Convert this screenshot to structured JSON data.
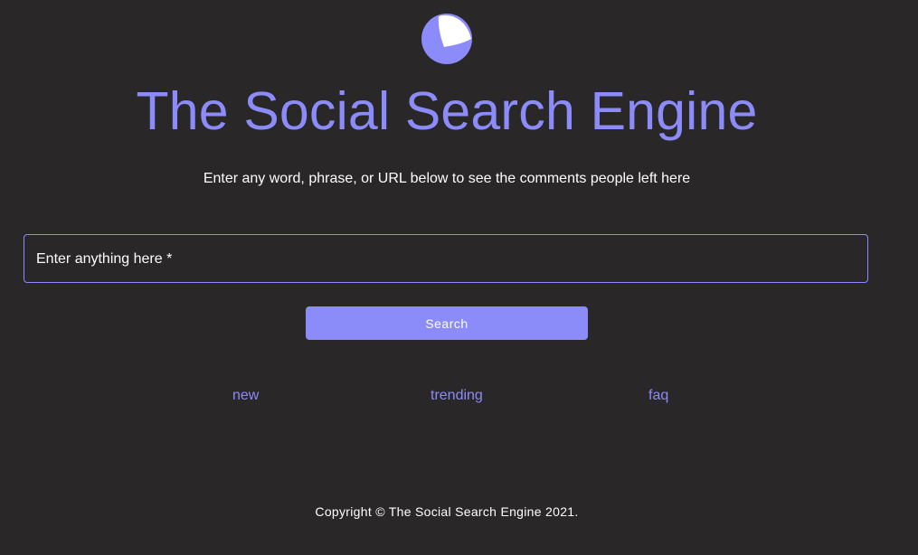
{
  "header": {
    "logo_icon": "moon-logo-icon",
    "title": "The Social Search Engine",
    "subtitle": "Enter any word, phrase, or URL below to see the comments people left here"
  },
  "search": {
    "label": "Enter anything here *",
    "value": "",
    "button_label": "Search"
  },
  "nav": {
    "new": "new",
    "trending": "trending",
    "faq": "faq"
  },
  "footer": {
    "copyright": "Copyright © The Social Search Engine 2021."
  },
  "colors": {
    "background": "#292727",
    "accent": "#8b8bf9",
    "text": "#ffffff"
  }
}
